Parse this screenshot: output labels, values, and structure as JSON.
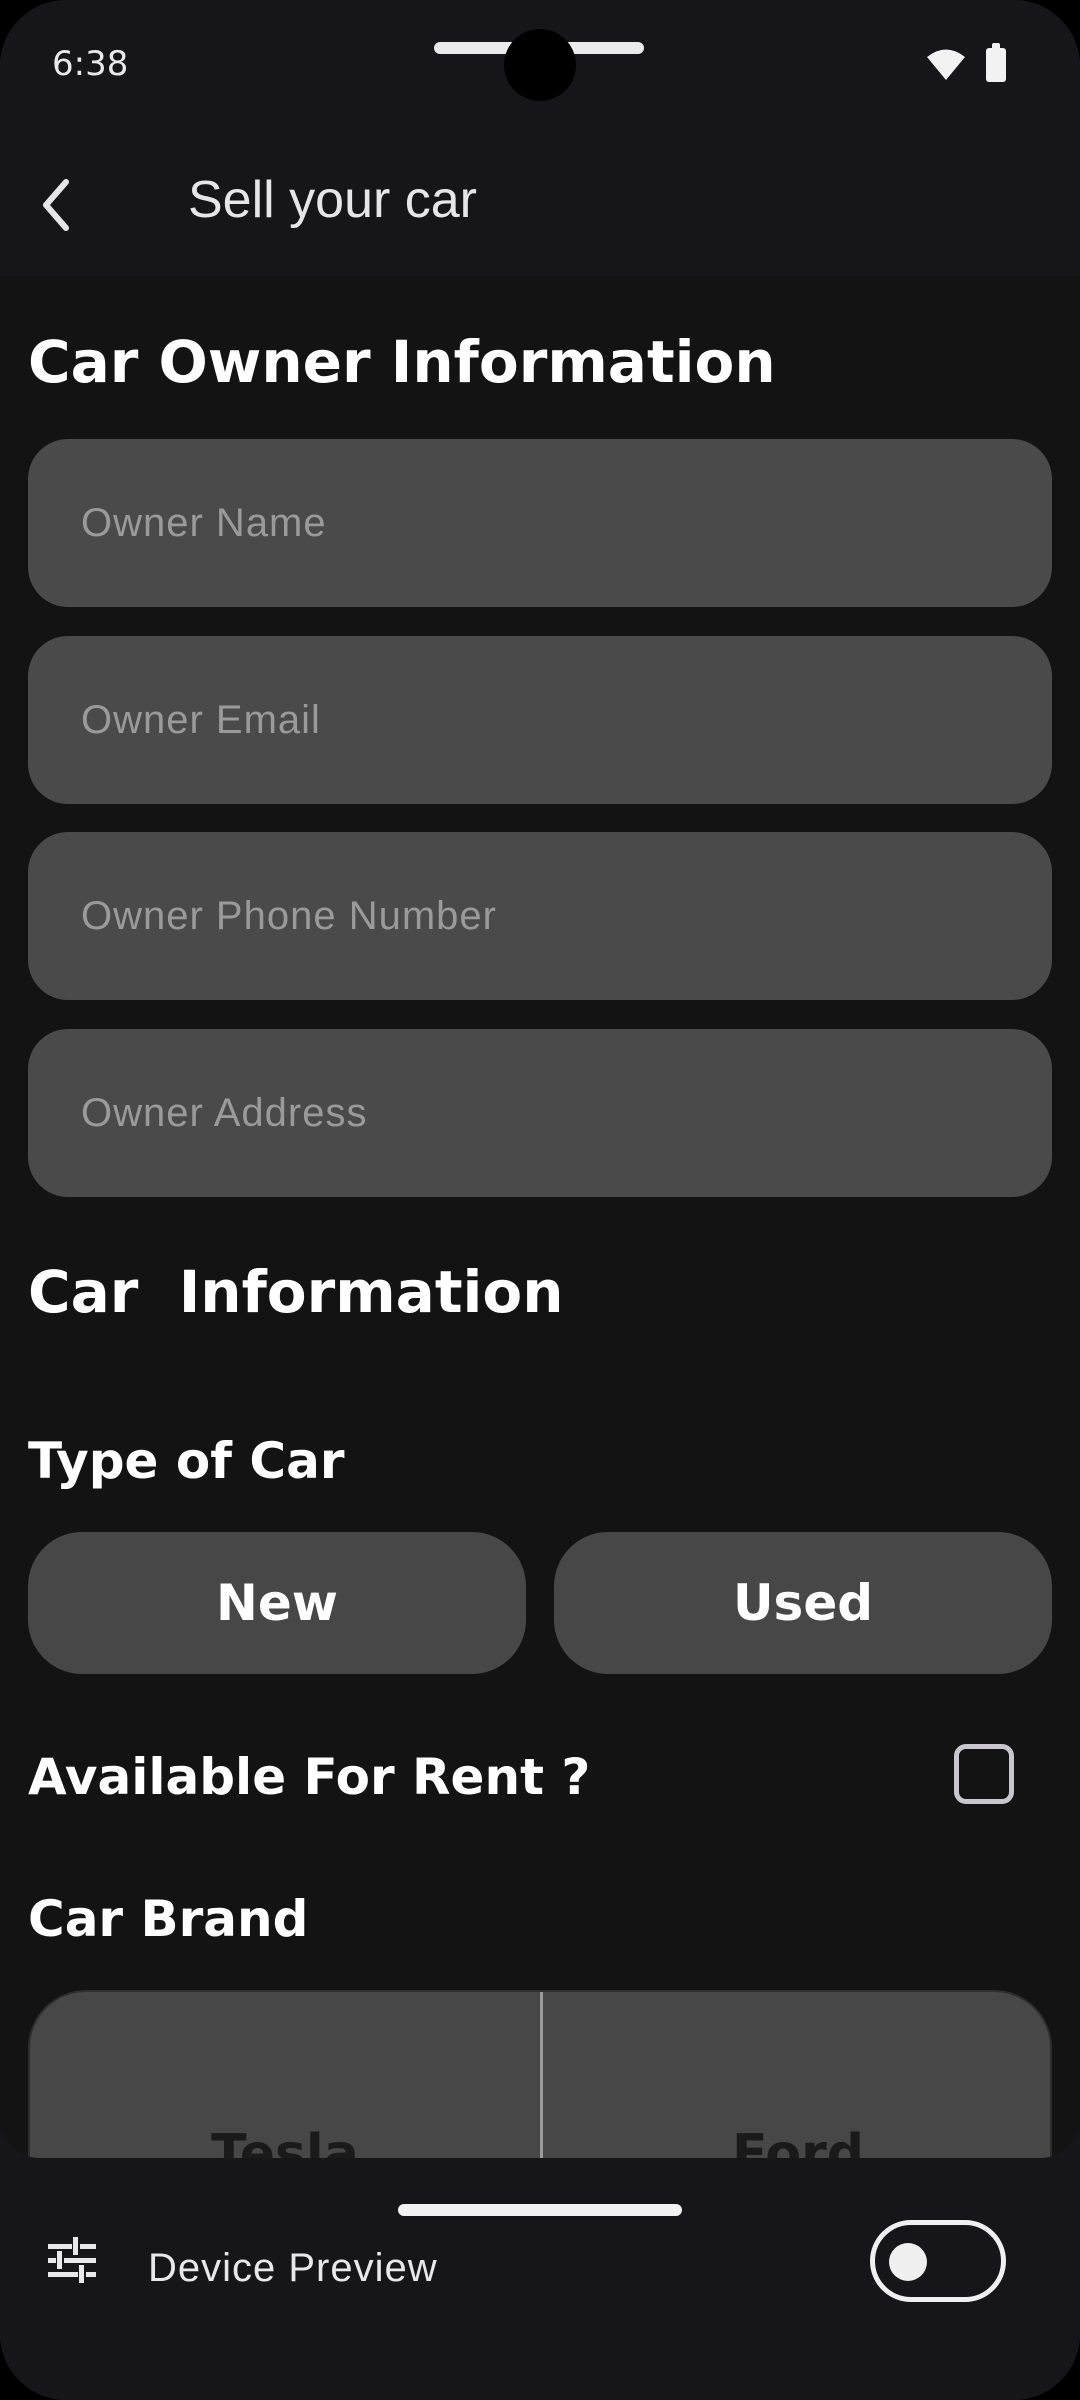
{
  "status_bar": {
    "time": "6:38"
  },
  "app_bar": {
    "title": "Sell your car"
  },
  "owner_section": {
    "heading": "Car Owner Information",
    "fields": {
      "name_placeholder": "Owner Name",
      "email_placeholder": "Owner Email",
      "phone_placeholder": "Owner Phone Number",
      "address_placeholder": "Owner Address"
    }
  },
  "car_section": {
    "heading": "Car  Information",
    "type_label": "Type of Car",
    "type_options": {
      "new": "New",
      "used": "Used"
    },
    "rent_label": "Available For Rent ?",
    "rent_checked": false,
    "brand_label": "Car Brand",
    "brands": [
      "Tesla",
      "Ford"
    ]
  },
  "device_preview": {
    "label": "Device Preview",
    "enabled": false
  },
  "colors": {
    "background": "#131313",
    "field": "#4a4a4a",
    "chrome": "#16151a"
  }
}
